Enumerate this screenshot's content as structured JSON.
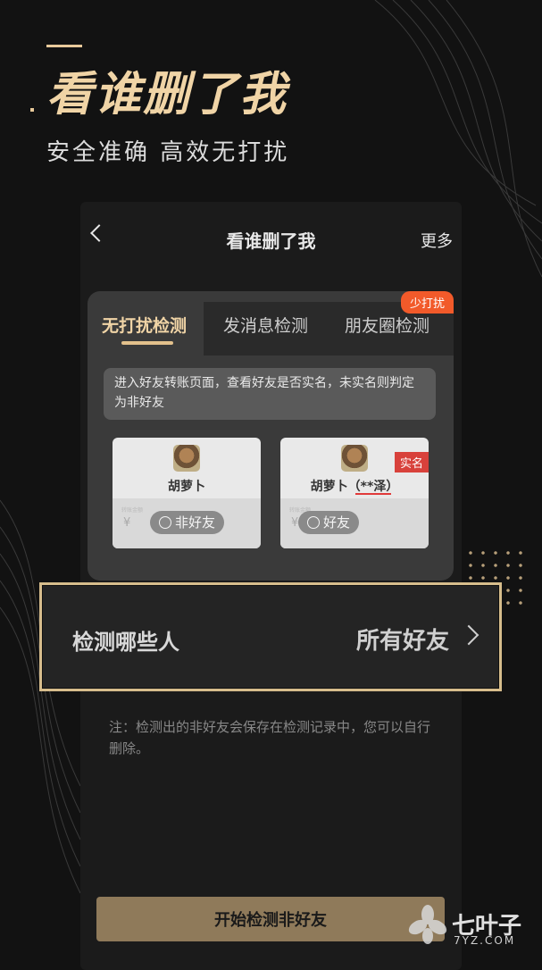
{
  "promo": {
    "title": "看谁删了我",
    "subtitle": "安全准确  高效无打扰"
  },
  "nav": {
    "back_icon": "chevron-left-icon",
    "title": "看谁删了我",
    "more_label": "更多"
  },
  "tabs": [
    {
      "label": "无打扰检测",
      "active": true
    },
    {
      "label": "发消息检测",
      "active": false
    },
    {
      "label": "朋友圈检测",
      "active": false
    }
  ],
  "badge": "少打扰",
  "notice": "进入好友转账页面，查看好友是否实名，未实名则判定为非好友",
  "examples": [
    {
      "name": "胡萝卜",
      "status": "非好友",
      "status_icon": "sad-face-icon"
    },
    {
      "name": "胡萝卜（**泽）",
      "status": "好友",
      "status_icon": "smile-face-icon",
      "tag": "实名"
    }
  ],
  "currency_symbol": "¥",
  "select_row": {
    "label": "检测哪些人",
    "value": "所有好友",
    "chevron_icon": "chevron-right-icon"
  },
  "note": "注：检测出的非好友会保存在检测记录中，您可以自行删除。",
  "start_button": "开始检测非好友",
  "watermark": {
    "name": "七叶子",
    "url": "7YZ.COM"
  },
  "colors": {
    "background": "#121212",
    "accent_gold": "#d7bd8c",
    "badge_orange": "#f25a2a",
    "tag_red": "#d8413b",
    "button": "#8f7a5a"
  }
}
